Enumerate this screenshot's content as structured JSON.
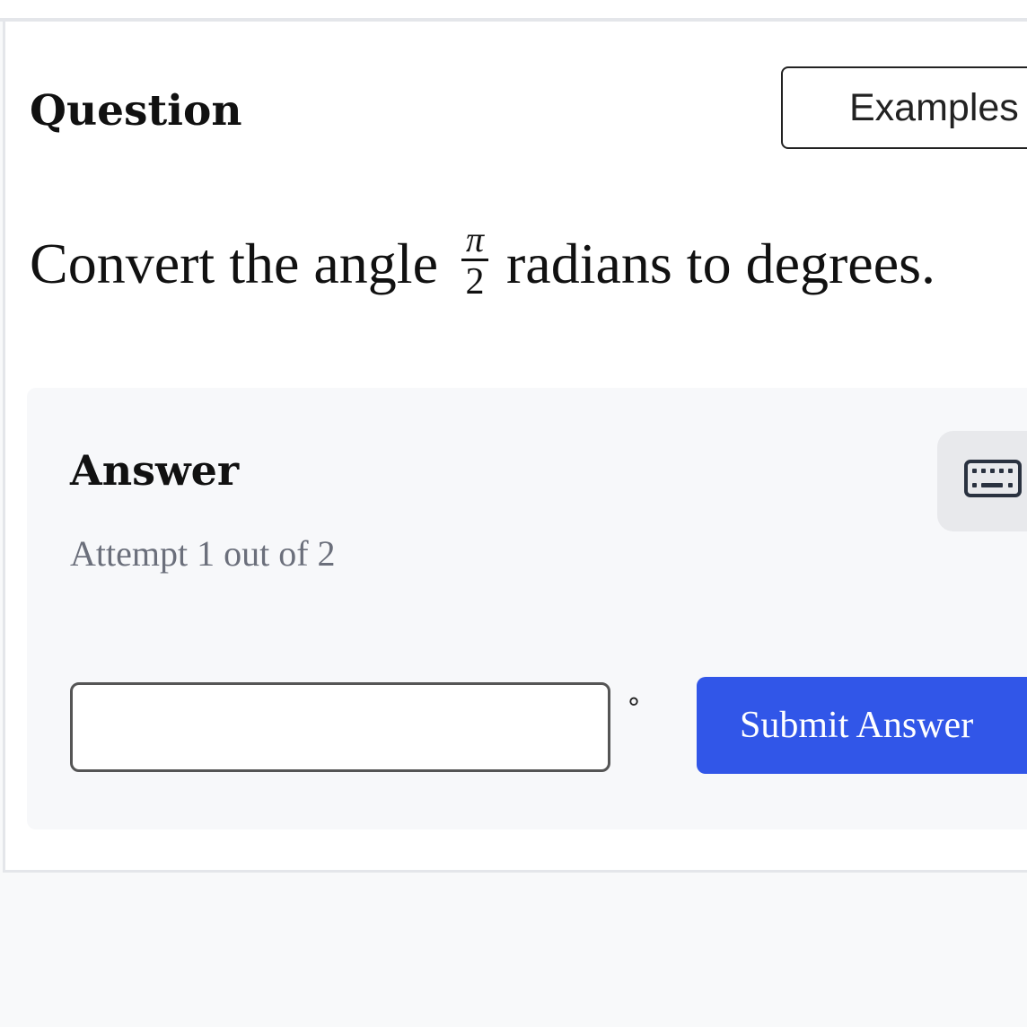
{
  "question": {
    "heading": "Question",
    "examples_label": "Examples",
    "text_before": "Convert the angle",
    "fraction": {
      "numerator": "π",
      "denominator": "2"
    },
    "text_after": "radians to degrees."
  },
  "answer": {
    "heading": "Answer",
    "attempt_text": "Attempt 1 out of 2",
    "keyboard_icon": "keyboard-icon",
    "input_value": "",
    "unit_symbol": "°",
    "submit_label": "Submit Answer"
  },
  "colors": {
    "accent": "#3156e8",
    "muted_text": "#6b6f7b",
    "panel_bg": "#f7f8fa"
  }
}
